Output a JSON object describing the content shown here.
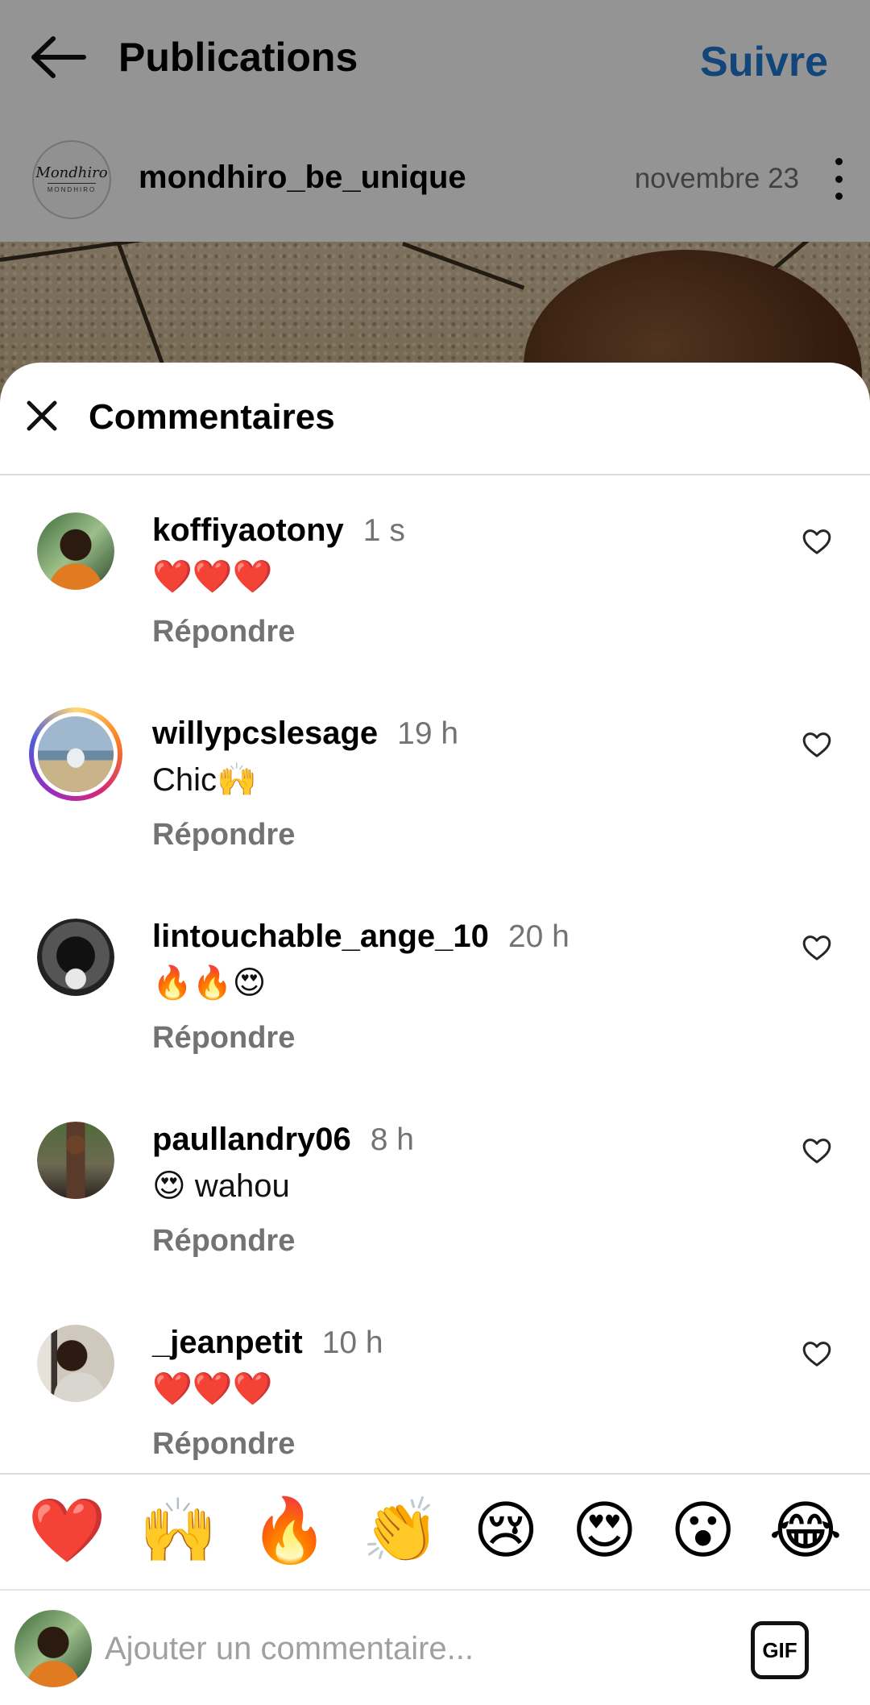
{
  "header": {
    "title": "Publications",
    "follow_label": "Suivre"
  },
  "post": {
    "username": "mondhiro_be_unique",
    "date": "novembre 23",
    "logo_text": "Mondhiro",
    "logo_subtext": "MONDHIRO"
  },
  "sheet": {
    "title": "Commentaires"
  },
  "comments": [
    {
      "username": "koffiyaotony",
      "time": "1 s",
      "text": "❤️❤️❤️",
      "reply_label": "Répondre"
    },
    {
      "username": "willypcslesage",
      "time": "19 h",
      "text": "Chic🙌",
      "reply_label": "Répondre"
    },
    {
      "username": "lintouchable_ange_10",
      "time": "20 h",
      "text": "🔥🔥😍",
      "reply_label": "Répondre"
    },
    {
      "username": "paullandry06",
      "time": "8 h",
      "text": "😍 wahou",
      "reply_label": "Répondre"
    },
    {
      "username": "_jeanpetit",
      "time": "10 h",
      "text": "❤️❤️❤️",
      "reply_label": "Répondre"
    }
  ],
  "quick_emojis": [
    "❤️",
    "🙌",
    "🔥",
    "👏",
    "😢",
    "😍",
    "😮",
    "😂"
  ],
  "composer": {
    "placeholder": "Ajouter un commentaire...",
    "gif_label": "GIF"
  },
  "colors": {
    "accent": "#1f77d0",
    "muted": "#737373",
    "divider": "#dbdbdb"
  },
  "icons": {
    "back": "arrow-left-icon",
    "more": "more-vertical-icon",
    "close": "close-icon",
    "like": "heart-outline-icon"
  }
}
